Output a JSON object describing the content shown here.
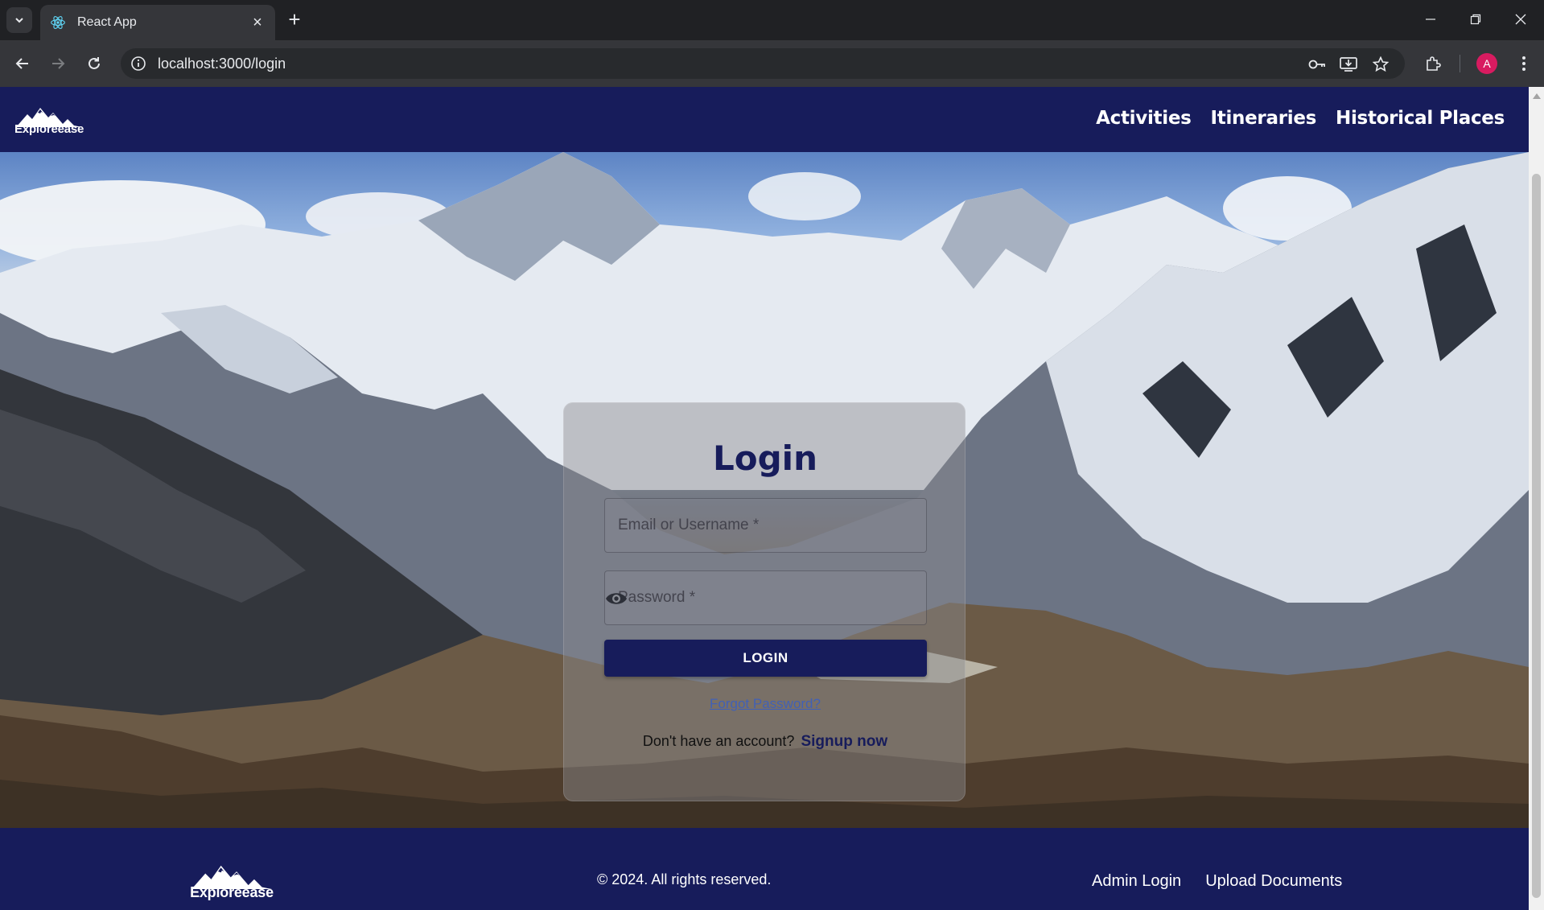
{
  "browser": {
    "tab_title": "React App",
    "url": "localhost:3000/login",
    "profile_initial": "A"
  },
  "navbar": {
    "logo_text": "Exploreease",
    "links": [
      "Activities",
      "Itineraries",
      "Historical Places"
    ]
  },
  "login": {
    "title": "Login",
    "email_placeholder": "Email or Username *",
    "password_placeholder": "Password *",
    "button_label": "LOGIN",
    "forgot_label": "Forgot Password?",
    "signup_prompt": "Don't have an account?",
    "signup_link": "Signup now"
  },
  "footer": {
    "logo_text": "Exploreease",
    "copyright": "© 2024. All rights reserved.",
    "links": [
      "Admin Login",
      "Upload Documents"
    ]
  },
  "colors": {
    "brand_navy": "#171c5b",
    "link_blue": "#2f5bd0",
    "chrome_dark": "#202124"
  }
}
